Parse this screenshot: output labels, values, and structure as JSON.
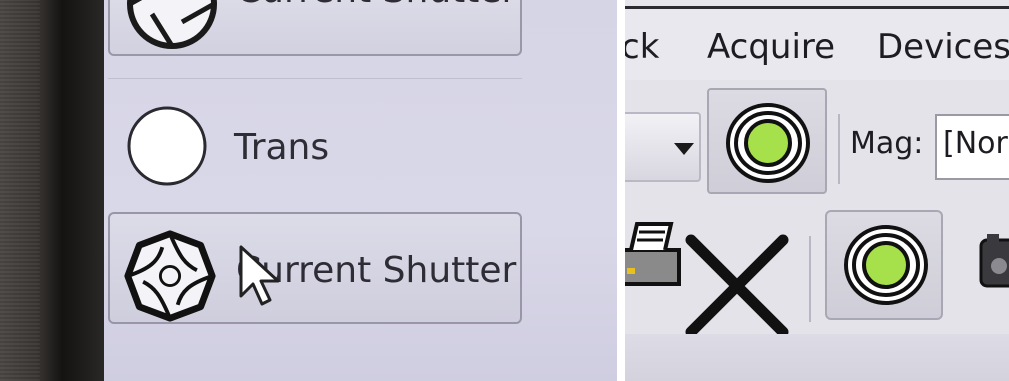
{
  "left_menu": {
    "items": [
      {
        "label": "Current Shutter",
        "icon": "shutter-icon"
      },
      {
        "label": "Trans",
        "icon": "circle-icon"
      },
      {
        "label": "Current Shutter",
        "icon": "shutter-icon"
      }
    ],
    "cursor": "arrow-cursor-icon"
  },
  "right_app": {
    "menubar": [
      "ck",
      "Acquire",
      "Devices"
    ],
    "toolbar": {
      "mag_label": "Mag:",
      "mag_value": "[Nor"
    },
    "icons": {
      "shutter_button": "green-shutter-icon",
      "printer": "printer-icon",
      "close": "close-x-icon",
      "camera": "camera-icon"
    }
  },
  "colors": {
    "green_light": "#a6e04a",
    "panel": "#d8d7e7",
    "toolbar": "#e4e3ea"
  }
}
